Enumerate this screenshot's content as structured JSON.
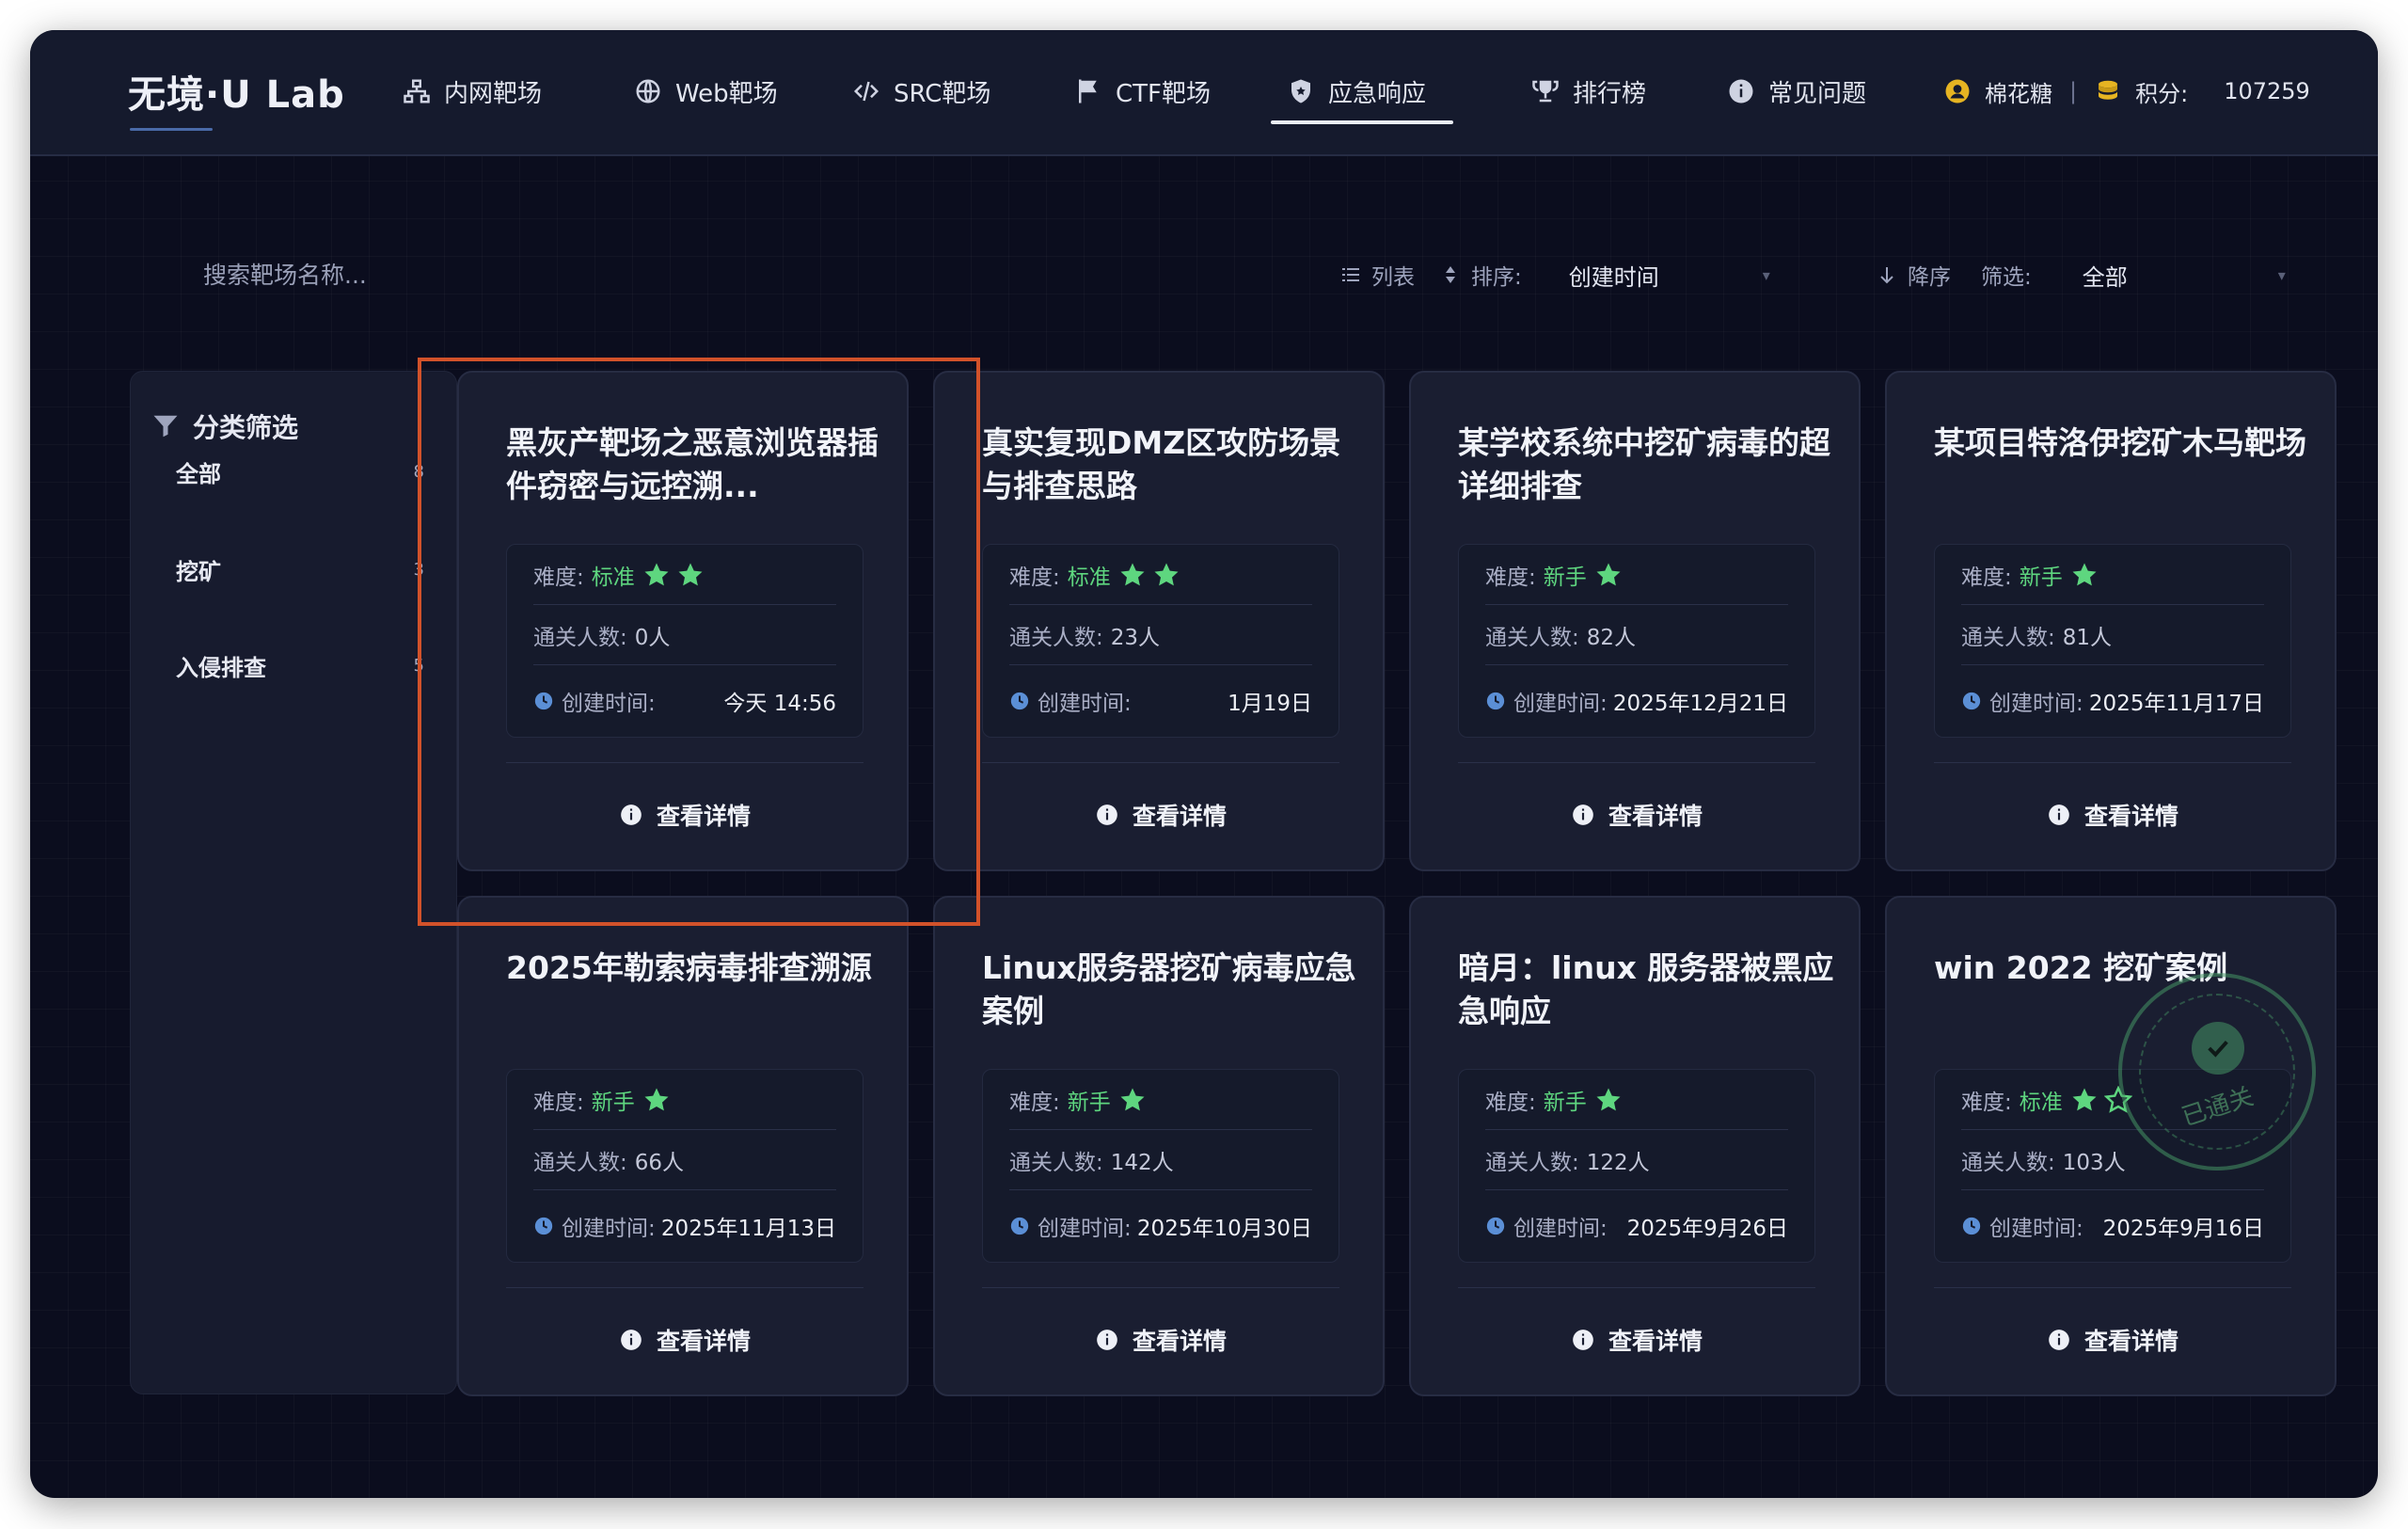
{
  "brand": {
    "logo_text": "无境·U Lab"
  },
  "nav": {
    "items": [
      {
        "label": "内网靶场",
        "icon": "network-icon"
      },
      {
        "label": "Web靶场",
        "icon": "globe-icon"
      },
      {
        "label": "SRC靶场",
        "icon": "code-icon"
      },
      {
        "label": "CTF靶场",
        "icon": "flag-icon"
      },
      {
        "label": "应急响应",
        "icon": "shield-icon",
        "active": true
      },
      {
        "label": "排行榜",
        "icon": "trophy-icon"
      },
      {
        "label": "常见问题",
        "icon": "info-icon"
      }
    ]
  },
  "user": {
    "name": "棉花糖",
    "points_label": "积分:",
    "points": "107259"
  },
  "toolbar": {
    "search_placeholder": "搜索靶场名称...",
    "view_label": "列表",
    "sort_label": "排序:",
    "sort_value": "创建时间",
    "order_label": "降序",
    "filter_label": "筛选:",
    "filter_value": "全部"
  },
  "sidebar": {
    "title": "分类筛选",
    "items": [
      {
        "label": "全部",
        "count": "8"
      },
      {
        "label": "挖矿",
        "count": "3"
      },
      {
        "label": "入侵排查",
        "count": "5"
      }
    ]
  },
  "labels": {
    "difficulty": "难度:",
    "passed": "通关人数:",
    "created": "创建时间:",
    "detail": "查看详情",
    "completed_stamp": "已通关"
  },
  "cards": [
    {
      "title": "黑灰产靶场之恶意浏览器插件窃密与远控溯...",
      "difficulty": "标准",
      "stars": 2,
      "passed": "0人",
      "created": "今天 14:56"
    },
    {
      "title": "真实复现DMZ区攻防场景与排查思路",
      "difficulty": "标准",
      "stars": 2,
      "passed": "23人",
      "created": "1月19日"
    },
    {
      "title": "某学校系统中挖矿病毒的超详细排查",
      "difficulty": "新手",
      "stars": 1,
      "passed": "82人",
      "created": "2025年12月21日"
    },
    {
      "title": "某项目特洛伊挖矿木马靶场",
      "difficulty": "新手",
      "stars": 1,
      "passed": "81人",
      "created": "2025年11月17日"
    },
    {
      "title": "2025年勒索病毒排查溯源",
      "difficulty": "新手",
      "stars": 1,
      "passed": "66人",
      "created": "2025年11月13日"
    },
    {
      "title": "Linux服务器挖矿病毒应急案例",
      "difficulty": "新手",
      "stars": 1,
      "passed": "142人",
      "created": "2025年10月30日"
    },
    {
      "title": "暗月：linux 服务器被黑应急响应",
      "difficulty": "新手",
      "stars": 1,
      "passed": "122人",
      "created": "2025年9月26日"
    },
    {
      "title": "win 2022 挖矿案例",
      "difficulty": "标准",
      "stars": 2,
      "passed": "103人",
      "created": "2025年9月16日",
      "completed": true
    }
  ],
  "colors": {
    "background": "#0b0d1e",
    "card": "#1a1e31",
    "difficulty_green": "#5ed67f",
    "clock_blue": "#5b8fd6",
    "highlight_orange": "#d2522a"
  }
}
